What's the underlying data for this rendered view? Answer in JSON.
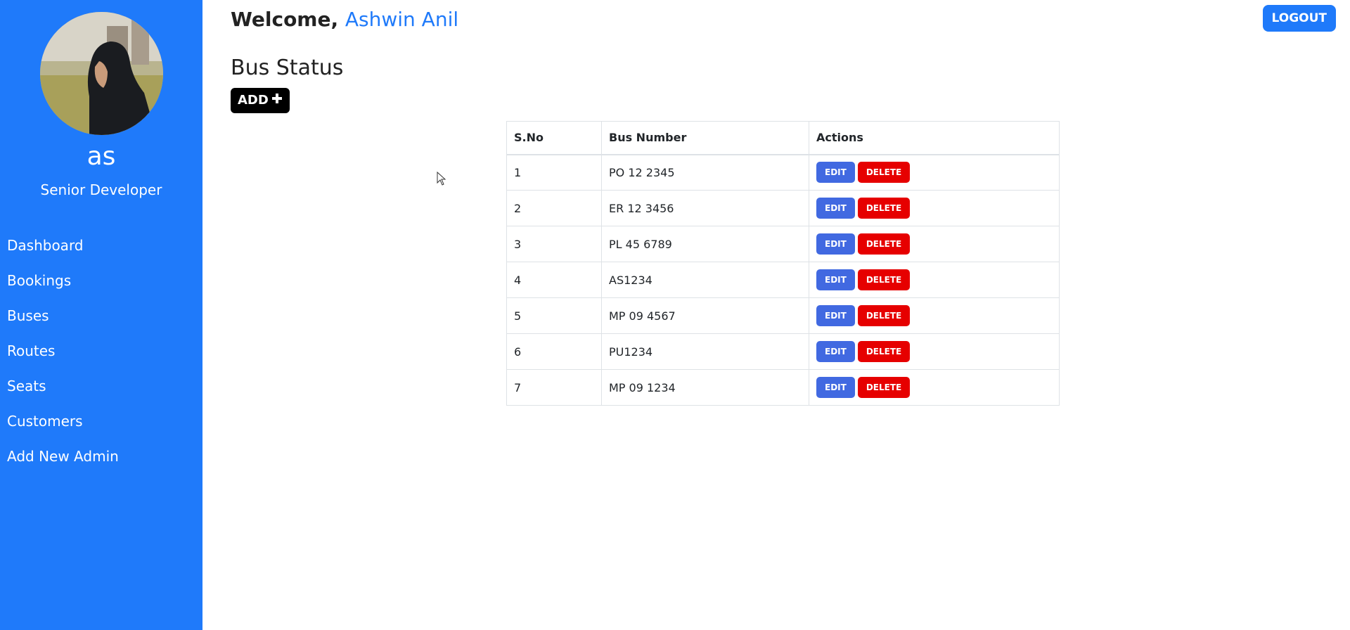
{
  "sidebar": {
    "profile_name": "as",
    "profile_role": "Senior Developer",
    "nav": [
      "Dashboard",
      "Bookings",
      "Buses",
      "Routes",
      "Seats",
      "Customers",
      "Add New Admin"
    ]
  },
  "header": {
    "welcome_prefix": "Welcome, ",
    "user_name": "Ashwin Anil",
    "logout_label": "LOGOUT"
  },
  "main": {
    "title": "Bus Status",
    "add_label": "ADD",
    "add_icon": "plus-icon",
    "table": {
      "columns": [
        "S.No",
        "Bus Number",
        "Actions"
      ],
      "rows": [
        {
          "sno": "1",
          "bus": "PO 12 2345"
        },
        {
          "sno": "2",
          "bus": "ER 12 3456"
        },
        {
          "sno": "3",
          "bus": "PL 45 6789"
        },
        {
          "sno": "4",
          "bus": "AS1234"
        },
        {
          "sno": "5",
          "bus": "MP 09 4567"
        },
        {
          "sno": "6",
          "bus": "PU1234"
        },
        {
          "sno": "7",
          "bus": "MP 09 1234"
        }
      ],
      "edit_label": "EDIT",
      "delete_label": "DELETE"
    }
  },
  "colors": {
    "sidebar_bg": "#1f7afa",
    "edit": "#4169e1",
    "delete": "#e60000"
  }
}
